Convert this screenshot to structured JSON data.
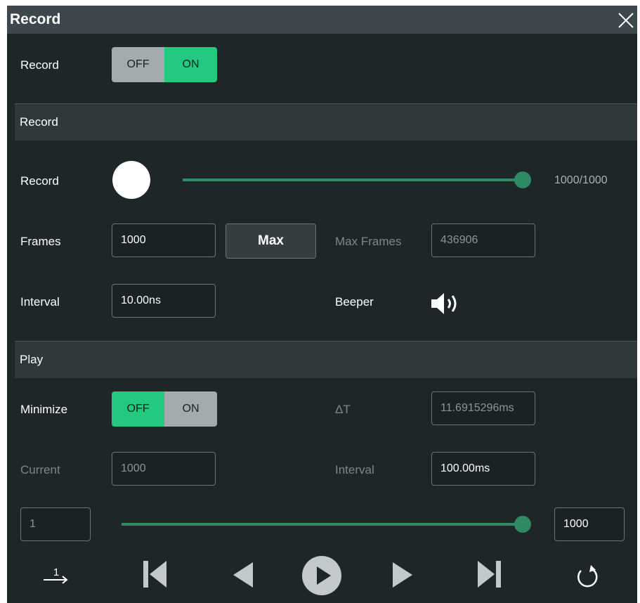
{
  "title": "Record",
  "record_toggle": {
    "label": "Record",
    "off": "OFF",
    "on": "ON",
    "state": "ON"
  },
  "record_section": {
    "header": "Record",
    "record_label": "Record",
    "progress_text": "1000/1000",
    "progress_fraction": 1.0,
    "frames_label": "Frames",
    "frames_value": "1000",
    "max_button": "Max",
    "max_frames_label": "Max Frames",
    "max_frames_value": "436906",
    "interval_label": "Interval",
    "interval_value": "10.00ns",
    "beeper_label": "Beeper",
    "beeper_icon": "speaker-on-icon"
  },
  "play_section": {
    "header": "Play",
    "minimize_label": "Minimize",
    "minimize_off": "OFF",
    "minimize_on": "ON",
    "minimize_state": "OFF",
    "delta_t_label": "ΔT",
    "delta_t_value": "11.6915296ms",
    "current_label": "Current",
    "current_value": "1000",
    "interval_label": "Interval",
    "interval_value": "100.00ms",
    "range_start": "1",
    "range_end": "1000",
    "range_fraction": 1.0
  },
  "controls": [
    "step-order-icon",
    "first-frame-icon",
    "prev-frame-icon",
    "play-icon",
    "next-frame-icon",
    "last-frame-icon",
    "repeat-icon"
  ],
  "colors": {
    "accent_green": "#22c97e",
    "slider_green": "#2e8a62",
    "background": "#1f2628"
  }
}
